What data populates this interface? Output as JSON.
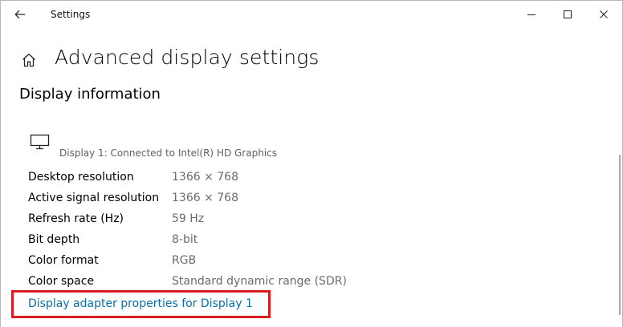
{
  "window": {
    "title": "Settings"
  },
  "header": {
    "page_title": "Advanced display settings"
  },
  "section": {
    "title": "Display information",
    "display_connected": "Display 1: Connected to Intel(R) HD Graphics"
  },
  "info_rows": [
    {
      "label": "Desktop resolution",
      "value": "1366 × 768"
    },
    {
      "label": "Active signal resolution",
      "value": "1366 × 768"
    },
    {
      "label": "Refresh rate (Hz)",
      "value": "59 Hz"
    },
    {
      "label": "Bit depth",
      "value": "8-bit"
    },
    {
      "label": "Color format",
      "value": "RGB"
    },
    {
      "label": "Color space",
      "value": "Standard dynamic range (SDR)"
    }
  ],
  "link": {
    "label": "Display adapter properties for Display 1"
  },
  "icons": {
    "back": "back-arrow-icon",
    "home": "home-icon",
    "monitor": "monitor-icon",
    "minimize": "minimize-icon",
    "maximize": "maximize-icon",
    "close": "close-icon"
  },
  "colors": {
    "link": "#0a6fa8",
    "highlight": "#d91c20",
    "secondary_text": "#6b6b6b"
  }
}
